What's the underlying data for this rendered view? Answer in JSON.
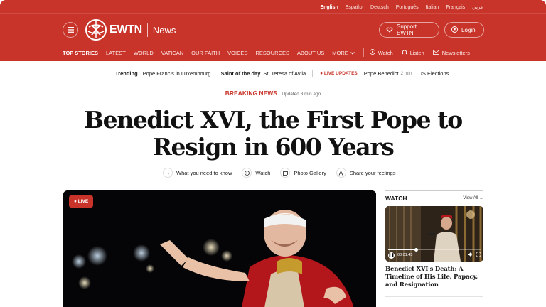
{
  "languages": [
    "English",
    "Español",
    "Deutsch",
    "Português",
    "Italian",
    "Français",
    "عربي"
  ],
  "brand": {
    "name": "EWTN",
    "section": "News"
  },
  "header": {
    "support_label": "Support EWTN",
    "login_label": "Login"
  },
  "nav": {
    "items": [
      "TOP STORIES",
      "LATEST",
      "WORLD",
      "VATICAN",
      "OUR FAITH",
      "VOICES",
      "RESOURCES",
      "ABOUT US",
      "MORE"
    ],
    "media": [
      "Watch",
      "Listen",
      "Newsletters"
    ]
  },
  "trending": {
    "label": "Trending",
    "topic": "Pope Francis in Luxembourg",
    "saint_label": "Saint of the day",
    "saint": "St. Teresa of Avila",
    "live_label": "LIVE UPDATES",
    "live_topic": "Pope Benedict",
    "live_time": "2 min",
    "other": "US Elections"
  },
  "article": {
    "kicker": "BREAKING NEWS",
    "updated": "Updated 3 min ago",
    "headline_line1": "Benedict XVI, the First Pope to",
    "headline_line2": "Resign in 600 Years",
    "actions": [
      "What you need to know",
      "Watch",
      "Photo Gallery",
      "Share your feelings"
    ],
    "live_badge": "LIVE"
  },
  "watch": {
    "title": "WATCH",
    "view_all": "View All",
    "video_time": "00:01:45",
    "video_progress": 0.3,
    "story": "Benedict XVI's Death: A Timeline of His Life, Papacy, and Resignation"
  },
  "colors": {
    "brand_red": "#c8342a"
  }
}
